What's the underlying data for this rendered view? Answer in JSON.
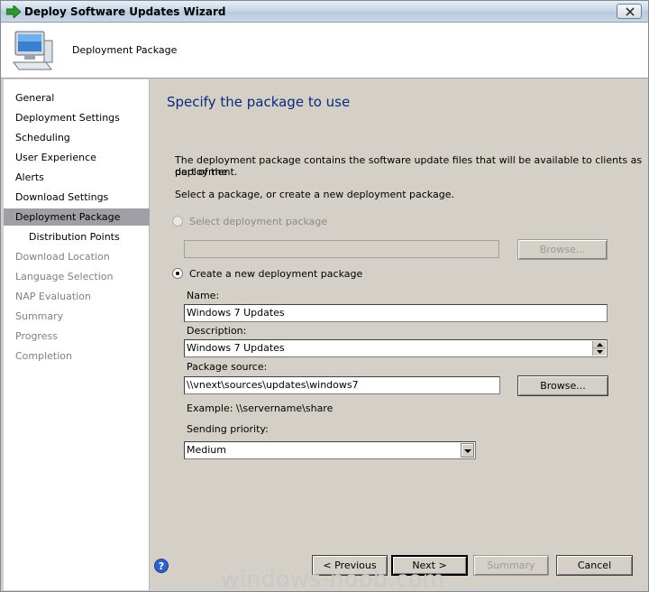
{
  "window": {
    "title": "Deploy Software Updates Wizard"
  },
  "header": {
    "title": "Deployment Package"
  },
  "nav": {
    "items": [
      {
        "label": "General",
        "state": "normal"
      },
      {
        "label": "Deployment Settings",
        "state": "normal"
      },
      {
        "label": "Scheduling",
        "state": "normal"
      },
      {
        "label": "User Experience",
        "state": "normal"
      },
      {
        "label": "Alerts",
        "state": "normal"
      },
      {
        "label": "Download Settings",
        "state": "normal"
      },
      {
        "label": "Deployment Package",
        "state": "selected"
      },
      {
        "label": "Distribution Points",
        "state": "sub"
      },
      {
        "label": "Download Location",
        "state": "disabled"
      },
      {
        "label": "Language Selection",
        "state": "disabled"
      },
      {
        "label": "NAP Evaluation",
        "state": "disabled"
      },
      {
        "label": "Summary",
        "state": "disabled"
      },
      {
        "label": "Progress",
        "state": "disabled"
      },
      {
        "label": "Completion",
        "state": "disabled"
      }
    ]
  },
  "content": {
    "title": "Specify the package to use",
    "intro_line1": "The deployment package contains the software update files that will be available to clients as part of the",
    "intro_line2": "deployment.",
    "instruction": "Select a package, or create a new deployment package.",
    "select_option": {
      "label": "Select deployment package",
      "selected": false,
      "enabled": false
    },
    "select_field_value": "",
    "select_browse_label": "Browse...",
    "create_option": {
      "label": "Create a new deployment package",
      "selected": true
    },
    "name_label": "Name:",
    "name_value": "Windows 7 Updates",
    "description_label": "Description:",
    "description_value": "Windows 7 Updates",
    "source_label": "Package source:",
    "source_value": "\\\\vnext\\sources\\updates\\windows7",
    "source_browse_label": "Browse...",
    "example_text": "Example: \\\\servername\\share",
    "priority_label": "Sending priority:",
    "priority_value": "Medium"
  },
  "footer": {
    "previous_label": "< Previous",
    "next_label": "Next >",
    "summary_label": "Summary",
    "cancel_label": "Cancel"
  },
  "watermark": "windows-noob.com",
  "colors": {
    "title_blue": "#0b2a7a",
    "nav_selected": "#9ea0a6",
    "dialog_bg": "#d4d0c8"
  }
}
